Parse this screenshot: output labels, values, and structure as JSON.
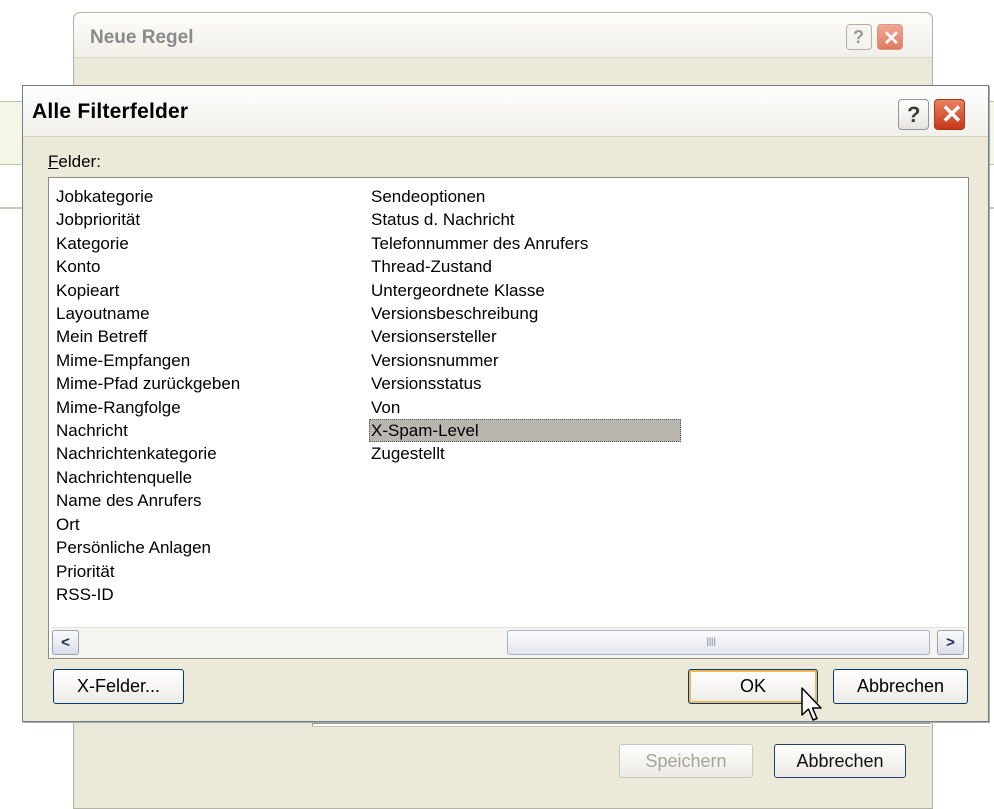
{
  "background_window": {
    "title": "Neue Regel",
    "help_label": "?",
    "close_label": "✕",
    "save_label": "Speichern",
    "cancel_label": "Abbrechen"
  },
  "dialog": {
    "title": "Alle Filterfelder",
    "help_label": "?",
    "close_label": "✕",
    "fields_label_accel": "F",
    "fields_label_rest": "elder:",
    "fields_col1": [
      "Jobkategorie",
      "Jobpriorität",
      "Kategorie",
      "Konto",
      "Kopieart",
      "Layoutname",
      "Mein Betreff",
      "Mime-Empfangen",
      "Mime-Pfad zurückgeben",
      "Mime-Rangfolge",
      "Nachricht",
      "Nachrichtenkategorie",
      "Nachrichtenquelle",
      "Name des Anrufers",
      "Ort",
      "Persönliche Anlagen",
      "Priorität",
      "RSS-ID"
    ],
    "fields_col2": [
      "Sendeoptionen",
      "Status d. Nachricht",
      "Telefonnummer des Anrufers",
      "Thread-Zustand",
      "Untergeordnete Klasse",
      "Versionsbeschreibung",
      "Versionsersteller",
      "Versionsnummer",
      "Versionsstatus",
      "Von",
      "X-Spam-Level",
      "Zugestellt"
    ],
    "selected_field": "X-Spam-Level",
    "scroll_left": "<",
    "scroll_right": ">",
    "scroll_grip": "IIII",
    "xfelder_label": "X-Felder...",
    "ok_label": "OK",
    "cancel_label": "Abbrechen"
  },
  "icons": {
    "cursor": "mouse-pointer-icon"
  }
}
